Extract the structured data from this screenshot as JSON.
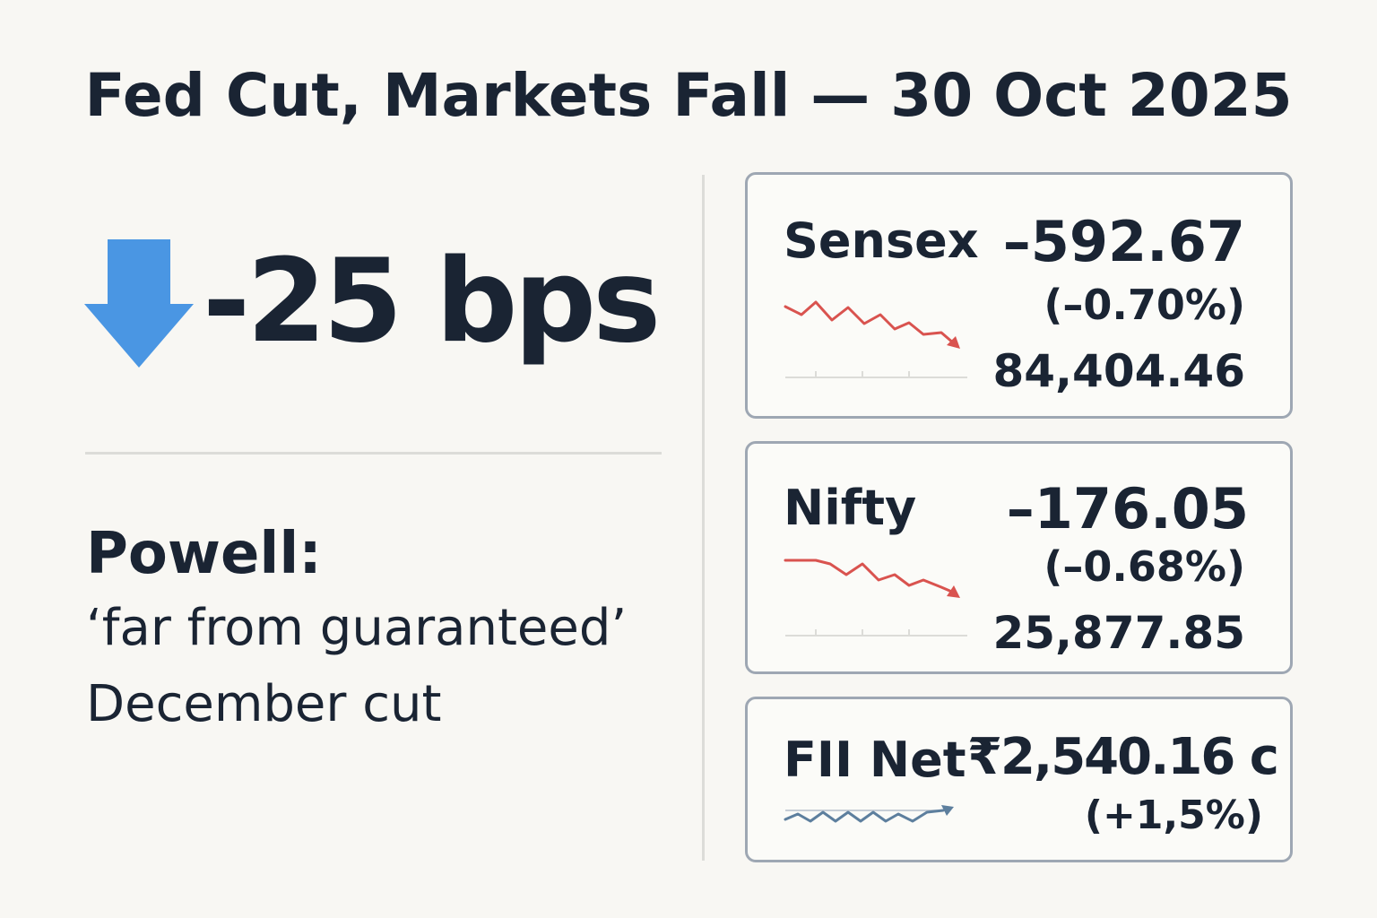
{
  "title": "Fed Cut, Markets Fall — 30 Oct 2025",
  "rate_cut": {
    "value": "-25 bps",
    "icon": "down-arrow-icon",
    "icon_color": "#4a96e3"
  },
  "quote": {
    "speaker": "Powell:",
    "line1": "‘far from guaranteed’",
    "line2": "December cut"
  },
  "cards": {
    "sensex": {
      "name": "Sensex",
      "change": "–592.67",
      "pct": "(–0.70%)",
      "level": "84,404.46",
      "trend": "down",
      "trend_color": "#d9534f"
    },
    "nifty": {
      "name": "Nifty",
      "change": "–176.05",
      "pct": "(–0.68%)",
      "level": "25,877.85",
      "trend": "down",
      "trend_color": "#d9534f"
    },
    "fii": {
      "name": "FII Net",
      "change": "₹2,540.16 c",
      "pct": "(+1,5%)",
      "trend": "up",
      "trend_color": "#5d7f9e"
    }
  },
  "colors": {
    "background": "#f8f7f3",
    "text": "#1a2433",
    "card_border": "#9ea7b3",
    "divider": "#dcdcd8"
  }
}
